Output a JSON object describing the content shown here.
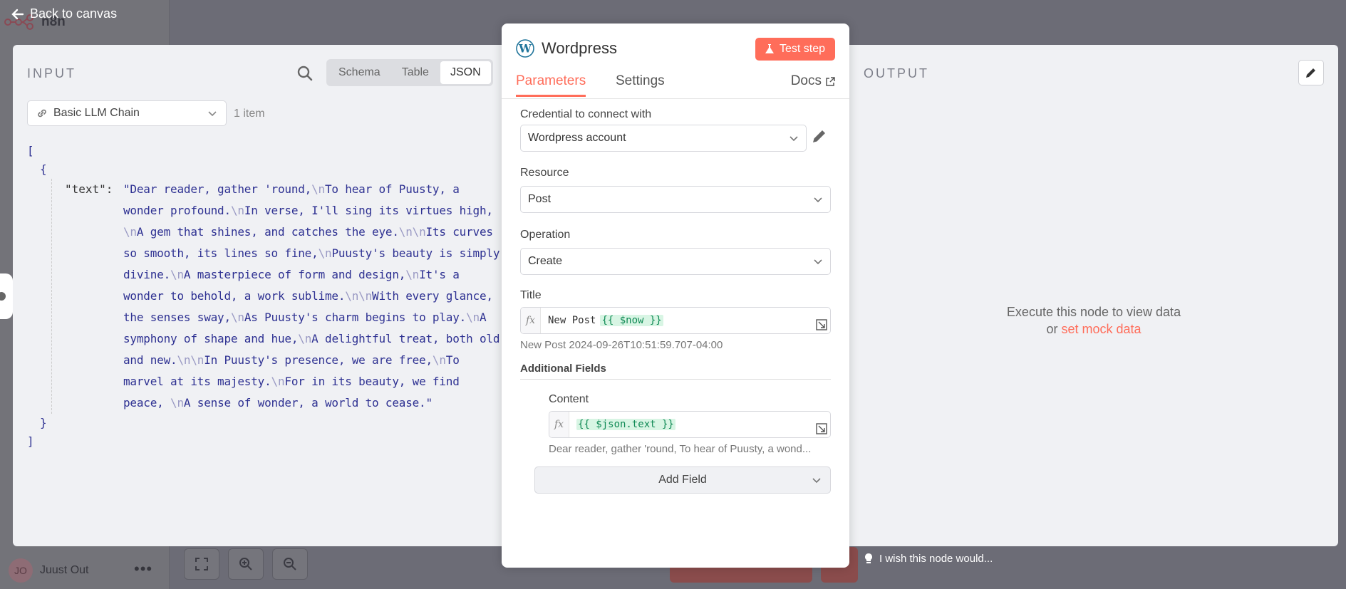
{
  "background": {
    "app_name": "n8n",
    "user_initials": "JO",
    "user_name": "Juust Out"
  },
  "back_button": {
    "label": "Back to canvas"
  },
  "input": {
    "title": "INPUT",
    "view_tabs": [
      "Schema",
      "Table",
      "JSON"
    ],
    "active_view": "JSON",
    "node_select": "Basic LLM Chain",
    "item_count": "1 item",
    "json": {
      "open_array": "[",
      "open_obj": "{",
      "key": "\"text\":",
      "close_obj": "}",
      "close_array": "]"
    }
  },
  "node": {
    "name": "Wordpress",
    "test_button": "Test step",
    "tabs": {
      "parameters": "Parameters",
      "settings": "Settings",
      "docs": "Docs"
    },
    "credential_label": "Credential to connect with",
    "credential_value": "Wordpress account",
    "resource_label": "Resource",
    "resource_value": "Post",
    "operation_label": "Operation",
    "operation_value": "Create",
    "title_label": "Title",
    "title_expr_text": "New Post",
    "title_expr_tmpl": "{{ $now }}",
    "title_hint": "New Post 2024-09-26T10:51:59.707-04:00",
    "additional_fields": "Additional Fields",
    "content_label": "Content",
    "content_expr_tmpl": "{{ $json.text }}",
    "content_hint": "Dear reader, gather 'round, To hear of Puusty, a wond...",
    "add_field": "Add Field"
  },
  "output": {
    "title": "OUTPUT",
    "message_line1": "Execute this node to view data",
    "message_or": "or",
    "message_link": "set mock data"
  },
  "feedback": "I wish this node would...",
  "colors": {
    "accent": "#ff6d5a",
    "json_value": "#2e3192",
    "expression_green": "#108a55"
  }
}
